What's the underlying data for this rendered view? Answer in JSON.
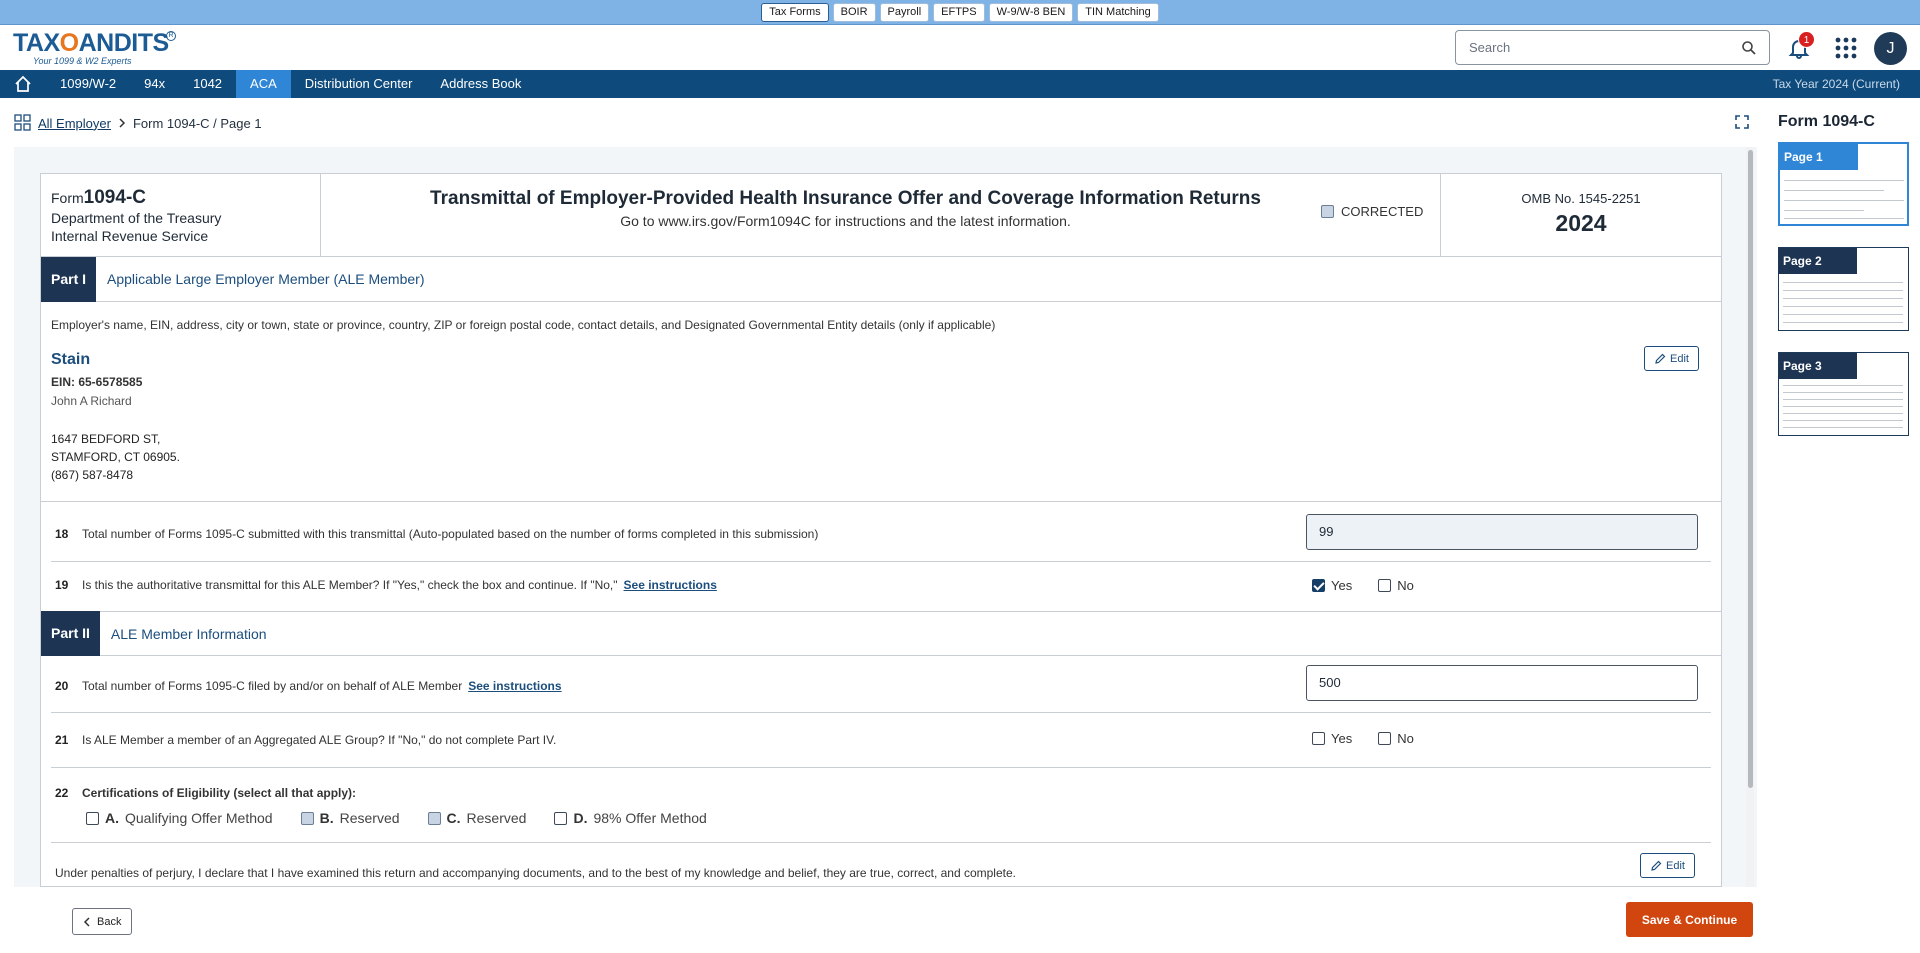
{
  "product_bar": [
    "Tax Forms",
    "BOIR",
    "Payroll",
    "EFTPS",
    "W-9/W-8 BEN",
    "TIN Matching"
  ],
  "logo": {
    "brand_left": "TAX",
    "brand_owl": "O",
    "brand_right": "ANDITS",
    "tagline": "Your 1099 & W2 Experts"
  },
  "header": {
    "search_placeholder": "Search",
    "notification_count": "1",
    "avatar_initial": "J"
  },
  "nav": {
    "items": [
      "1099/W-2",
      "94x",
      "1042",
      "ACA",
      "Distribution Center",
      "Address Book"
    ],
    "active": "ACA",
    "tax_year": "Tax Year 2024 (Current)"
  },
  "breadcrumb": {
    "link": "All Employer",
    "current": "Form 1094-C / Page 1"
  },
  "right_panel": {
    "title": "Form 1094-C",
    "pages": [
      "Page 1",
      "Page 2",
      "Page 3"
    ]
  },
  "form_header": {
    "form_prefix": "Form",
    "form_number": "1094-C",
    "dept_line1": "Department of the Treasury",
    "dept_line2": "Internal Revenue Service",
    "title": "Transmittal of Employer-Provided Health Insurance Offer and Coverage Information Returns",
    "subtitle": "Go to www.irs.gov/Form1094C for instructions and the latest information.",
    "corrected_label": "CORRECTED",
    "omb": "OMB No. 1545-2251",
    "year": "2024"
  },
  "part1": {
    "tag": "Part I",
    "title": "Applicable Large Employer Member (ALE Member)",
    "employer_desc": "Employer's name, EIN, address, city or town, state or province, country, ZIP or foreign postal code, contact details, and Designated Governmental Entity details (only if applicable)",
    "employer_name": "Stain",
    "ein": "EIN: 65-6578585",
    "contact_name": "John A Richard",
    "address_line1": "1647 BEDFORD ST,",
    "address_line2": "STAMFORD, CT 06905.",
    "phone": "(867) 587-8478",
    "edit_label": "Edit"
  },
  "line18": {
    "num": "18",
    "label": "Total number of Forms 1095-C submitted with this transmittal   (Auto-populated based on the number of forms completed in this submission)",
    "value": "99"
  },
  "line19": {
    "num": "19",
    "label": "Is this the authoritative transmittal for this ALE Member? If \"Yes,\" check the box and continue. If \"No,\"",
    "link": "See instructions",
    "yes": "Yes",
    "no": "No"
  },
  "part2": {
    "tag": "Part II",
    "title": "ALE Member Information"
  },
  "line20": {
    "num": "20",
    "label": "Total number of Forms 1095-C filed by and/or on behalf of ALE Member",
    "link": "See instructions",
    "value": "500"
  },
  "line21": {
    "num": "21",
    "label": "Is ALE Member a member of an Aggregated ALE Group? If \"No,\" do not complete Part IV.",
    "yes": "Yes",
    "no": "No"
  },
  "line22": {
    "num": "22",
    "label": "Certifications of Eligibility (select all that apply):",
    "options": [
      {
        "letter": "A.",
        "text": " Qualifying Offer Method"
      },
      {
        "letter": "B.",
        "text": "Reserved"
      },
      {
        "letter": "C.",
        "text": " Reserved"
      },
      {
        "letter": "D.",
        "text": " 98% Offer Method"
      }
    ]
  },
  "perjury": {
    "text": "Under penalties of perjury, I declare that I have examined this return and accompanying documents, and to the best of my knowledge and belief, they are true, correct, and complete.",
    "edit_label": "Edit"
  },
  "footer": {
    "back_label": "Back",
    "save_label": "Save & Continue"
  },
  "colors": {
    "nav_bg": "#0e4a7b",
    "nav_active": "#2f86d6",
    "part_tag_bg": "#1d3553",
    "accent_orange": "#d1460f",
    "product_bar_bg": "#7fb3e6"
  }
}
